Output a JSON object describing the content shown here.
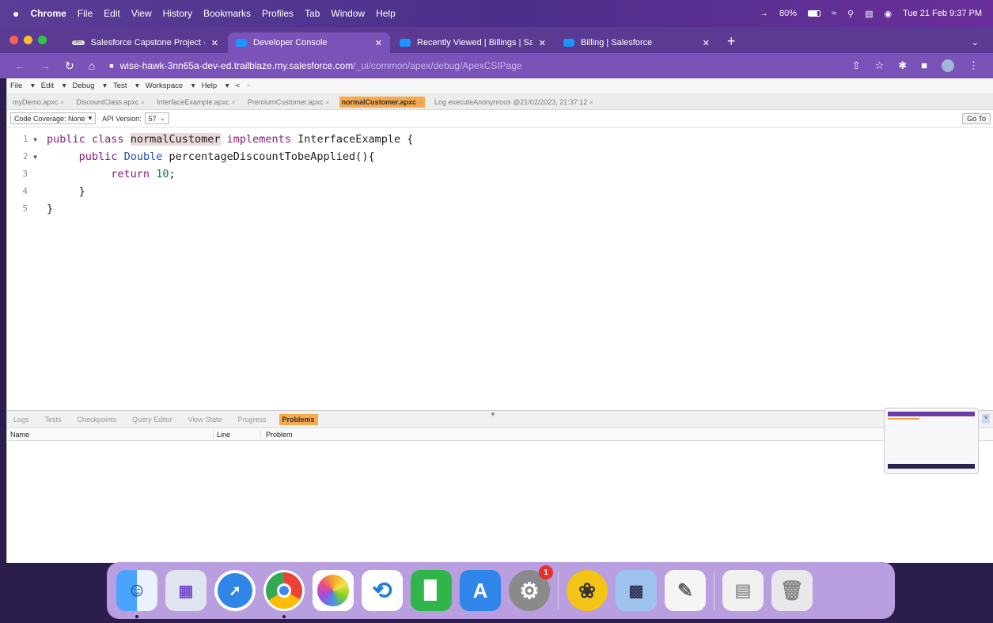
{
  "macos": {
    "apple_icon": "apple-icon",
    "app_name": "Chrome",
    "menus": [
      "File",
      "Edit",
      "View",
      "History",
      "Bookmarks",
      "Profiles",
      "Tab",
      "Window",
      "Help"
    ],
    "battery": "80%",
    "datetime": "Tue 21 Feb 9:37 PM"
  },
  "browser": {
    "tabs": [
      {
        "title": "Salesforce Capstone Project - ",
        "favicon": "DEL",
        "active": false
      },
      {
        "title": "Developer Console",
        "active": true
      },
      {
        "title": "Recently Viewed | Billings | Sal",
        "active": false
      },
      {
        "title": "Billing | Salesforce",
        "active": false
      }
    ],
    "new_tab": "+",
    "url_host": "wise-hawk-3nn65a-dev-ed.trailblaze.my.salesforce.com",
    "url_path": "/_ui/common/apex/debug/ApexCSIPage"
  },
  "console": {
    "menu": [
      "File",
      "Edit",
      "Debug",
      "Test",
      "Workspace",
      "Help"
    ],
    "nav_back": "<",
    "nav_fwd": ">",
    "file_tabs": [
      {
        "label": "myDemo.apxc",
        "active": false
      },
      {
        "label": "DiscountClass.apxc",
        "active": false
      },
      {
        "label": "InterfaceExample.apxc",
        "active": false
      },
      {
        "label": "PremiumCustomer.apxc",
        "active": false
      },
      {
        "label": "normalCustomer.apxc",
        "active": true
      },
      {
        "label": "Log executeAnonymous @21/02/2023, 21:37:12",
        "active": false
      }
    ],
    "code_coverage": "Code Coverage: None",
    "api_version_label": "API Version:",
    "api_version": "57",
    "goto": "Go To",
    "line_numbers": [
      "1",
      "2",
      "3",
      "4",
      "5"
    ],
    "code": {
      "l1_kw1": "public",
      "l1_kw2": "class",
      "l1_name": "normalCustomer",
      "l1_kw3": "implements",
      "l1_iface": "InterfaceExample {",
      "l2_kw1": "public",
      "l2_type": "Double",
      "l2_rest": "percentageDiscountTobeApplied(){",
      "l3_kw": "return",
      "l3_num": "10",
      "l3_semi": ";",
      "l4": "}",
      "l5": "}"
    },
    "panel_tabs": [
      {
        "label": "Logs",
        "active": false
      },
      {
        "label": "Tests",
        "active": false
      },
      {
        "label": "Checkpoints",
        "active": false
      },
      {
        "label": "Query Editor",
        "active": false
      },
      {
        "label": "View State",
        "active": false
      },
      {
        "label": "Progress",
        "active": false
      },
      {
        "label": "Problems",
        "active": true
      }
    ],
    "columns": {
      "name": "Name",
      "line": "Line",
      "problem": "Problem"
    }
  },
  "dock": {
    "apps": [
      {
        "name": "finder-icon",
        "color": "#3d8af0"
      },
      {
        "name": "launchpad-icon",
        "color": "#e0e4ee"
      },
      {
        "name": "safari-icon",
        "color": "#2f86e8"
      },
      {
        "name": "chrome-icon",
        "color": "#ffffff"
      },
      {
        "name": "photos-icon",
        "color": "#ffffff"
      },
      {
        "name": "vscode-icon",
        "color": "#ffffff"
      },
      {
        "name": "numbers-icon",
        "color": "#2fb54a"
      },
      {
        "name": "app-store-icon",
        "color": "#2f86e8"
      },
      {
        "name": "system-preferences-icon",
        "color": "#8a8a8a"
      },
      {
        "name": "chatgpt-icon",
        "color": "#f3c316"
      },
      {
        "name": "preview-icon",
        "color": "#9ec3ef"
      },
      {
        "name": "textedit-icon",
        "color": "#f5f5f5"
      },
      {
        "name": "document-icon",
        "color": "#f0f0f0"
      },
      {
        "name": "trash-icon",
        "color": "#e8e8ea"
      }
    ],
    "system_preferences_badge": "1"
  }
}
